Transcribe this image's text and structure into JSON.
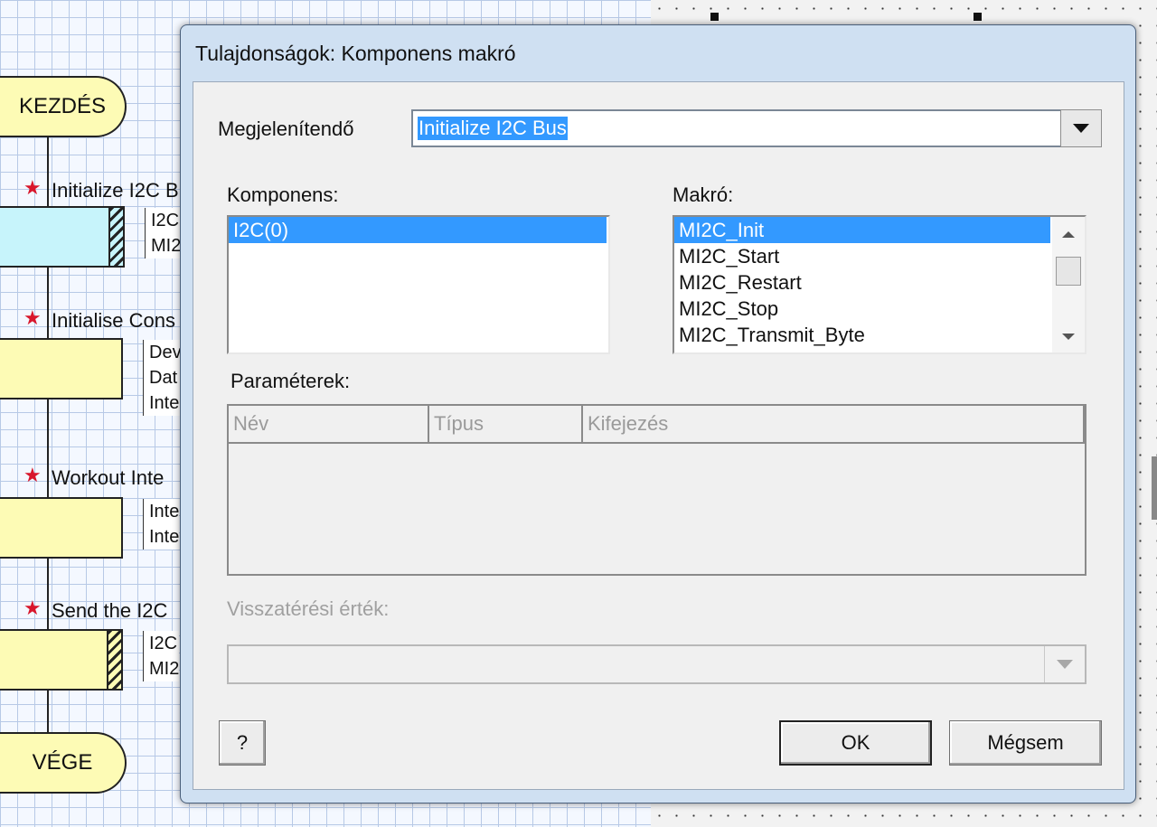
{
  "flowchart": {
    "start_label": "KEZDÉS",
    "end_label": "VÉGE",
    "blocks": [
      {
        "label": "Initialize I2C B",
        "notes": [
          "I2C",
          "MI2"
        ]
      },
      {
        "label": "Initialise Cons",
        "notes": [
          "Dev",
          "Dat",
          "Inte"
        ]
      },
      {
        "label": "Workout Inte",
        "notes": [
          "Inte",
          "Inte"
        ]
      },
      {
        "label": "Send the I2C",
        "notes": [
          "I2C",
          "MI2"
        ]
      }
    ]
  },
  "dialog": {
    "title": "Tulajdonságok: Komponens makró",
    "display_label": "Megjelenítendő",
    "display_value": "Initialize I2C Bus",
    "component_label": "Komponens:",
    "components": [
      "I2C(0)"
    ],
    "macro_label": "Makró:",
    "macros": [
      "MI2C_Init",
      "MI2C_Start",
      "MI2C_Restart",
      "MI2C_Stop",
      "MI2C_Transmit_Byte"
    ],
    "params_label": "Paraméterek:",
    "params_columns": [
      "Név",
      "Típus",
      "Kifejezés"
    ],
    "return_label": "Visszatérési érték:",
    "help_button": "?",
    "ok_button": "OK",
    "cancel_button": "Mégsem"
  },
  "colors": {
    "selection": "#3399ff",
    "terminal_fill": "#fdfbb5",
    "first_block_fill": "#c7f4fb",
    "block_fill": "#fdfbb5",
    "star": "#d8162b"
  }
}
